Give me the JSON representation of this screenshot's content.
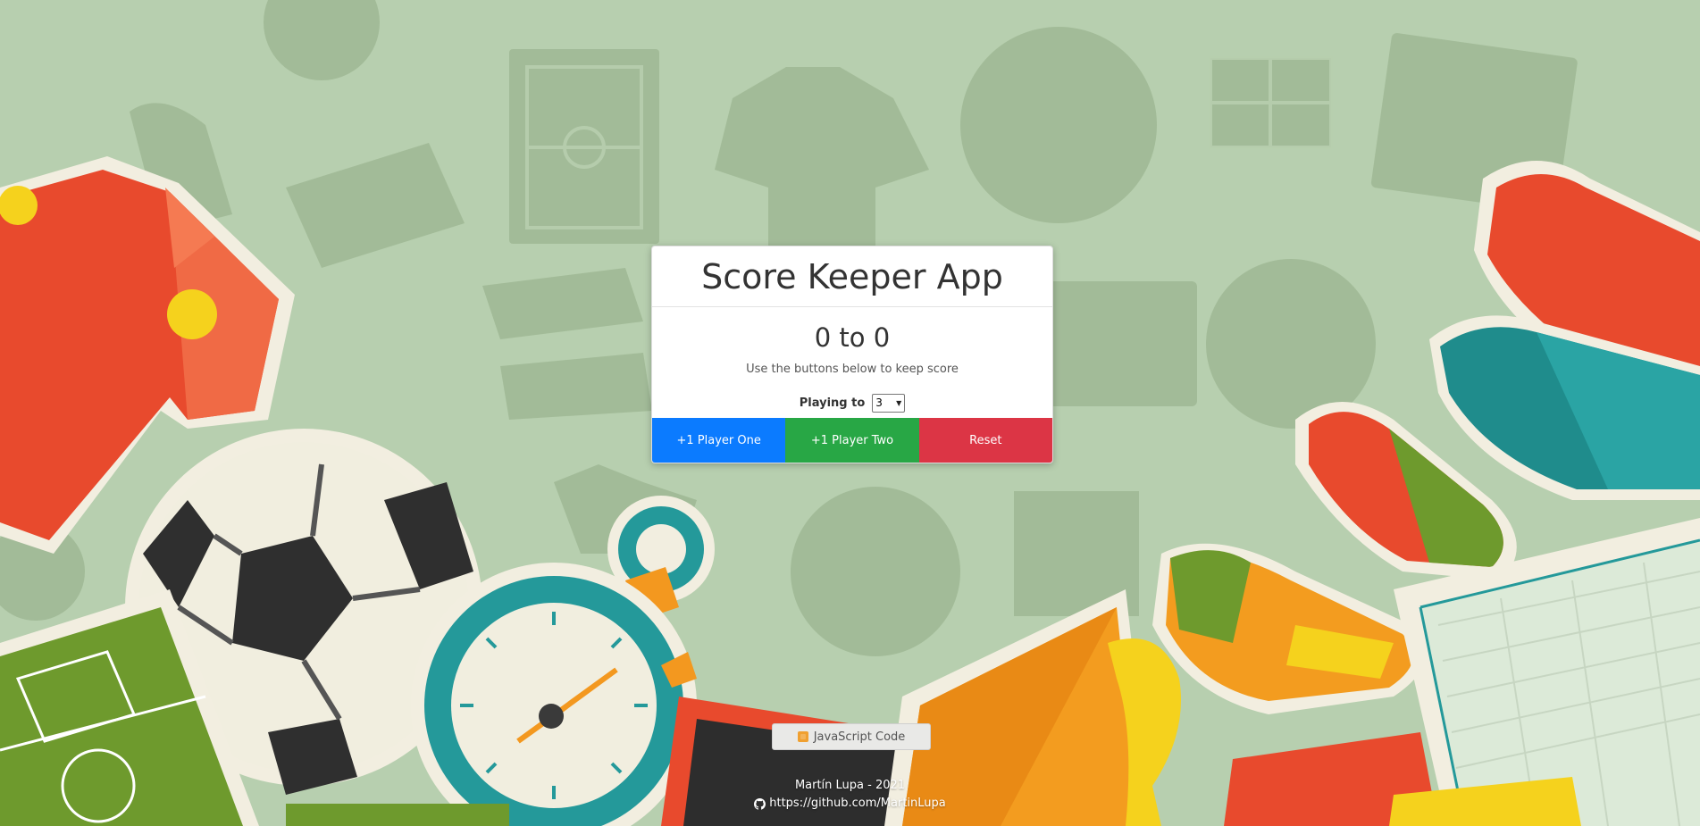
{
  "app": {
    "title": "Score Keeper App",
    "score_display": "0 to 0",
    "hint": "Use the buttons below to keep score",
    "playing_to_label": "Playing to",
    "playing_to_value": "3"
  },
  "buttons": {
    "player_one": "+1 Player One",
    "player_two": "+1 Player Two",
    "reset": "Reset"
  },
  "code_link": {
    "label": "JavaScript Code",
    "icon": "javascript-icon"
  },
  "footer": {
    "author": "Martín Lupa - 2021",
    "github": "https://github.com/MartinLupa",
    "github_icon": "github-icon"
  },
  "colors": {
    "background": "#b7cfaf",
    "player_one": "#0b7bff",
    "player_two": "#28a745",
    "reset": "#dc3545"
  }
}
